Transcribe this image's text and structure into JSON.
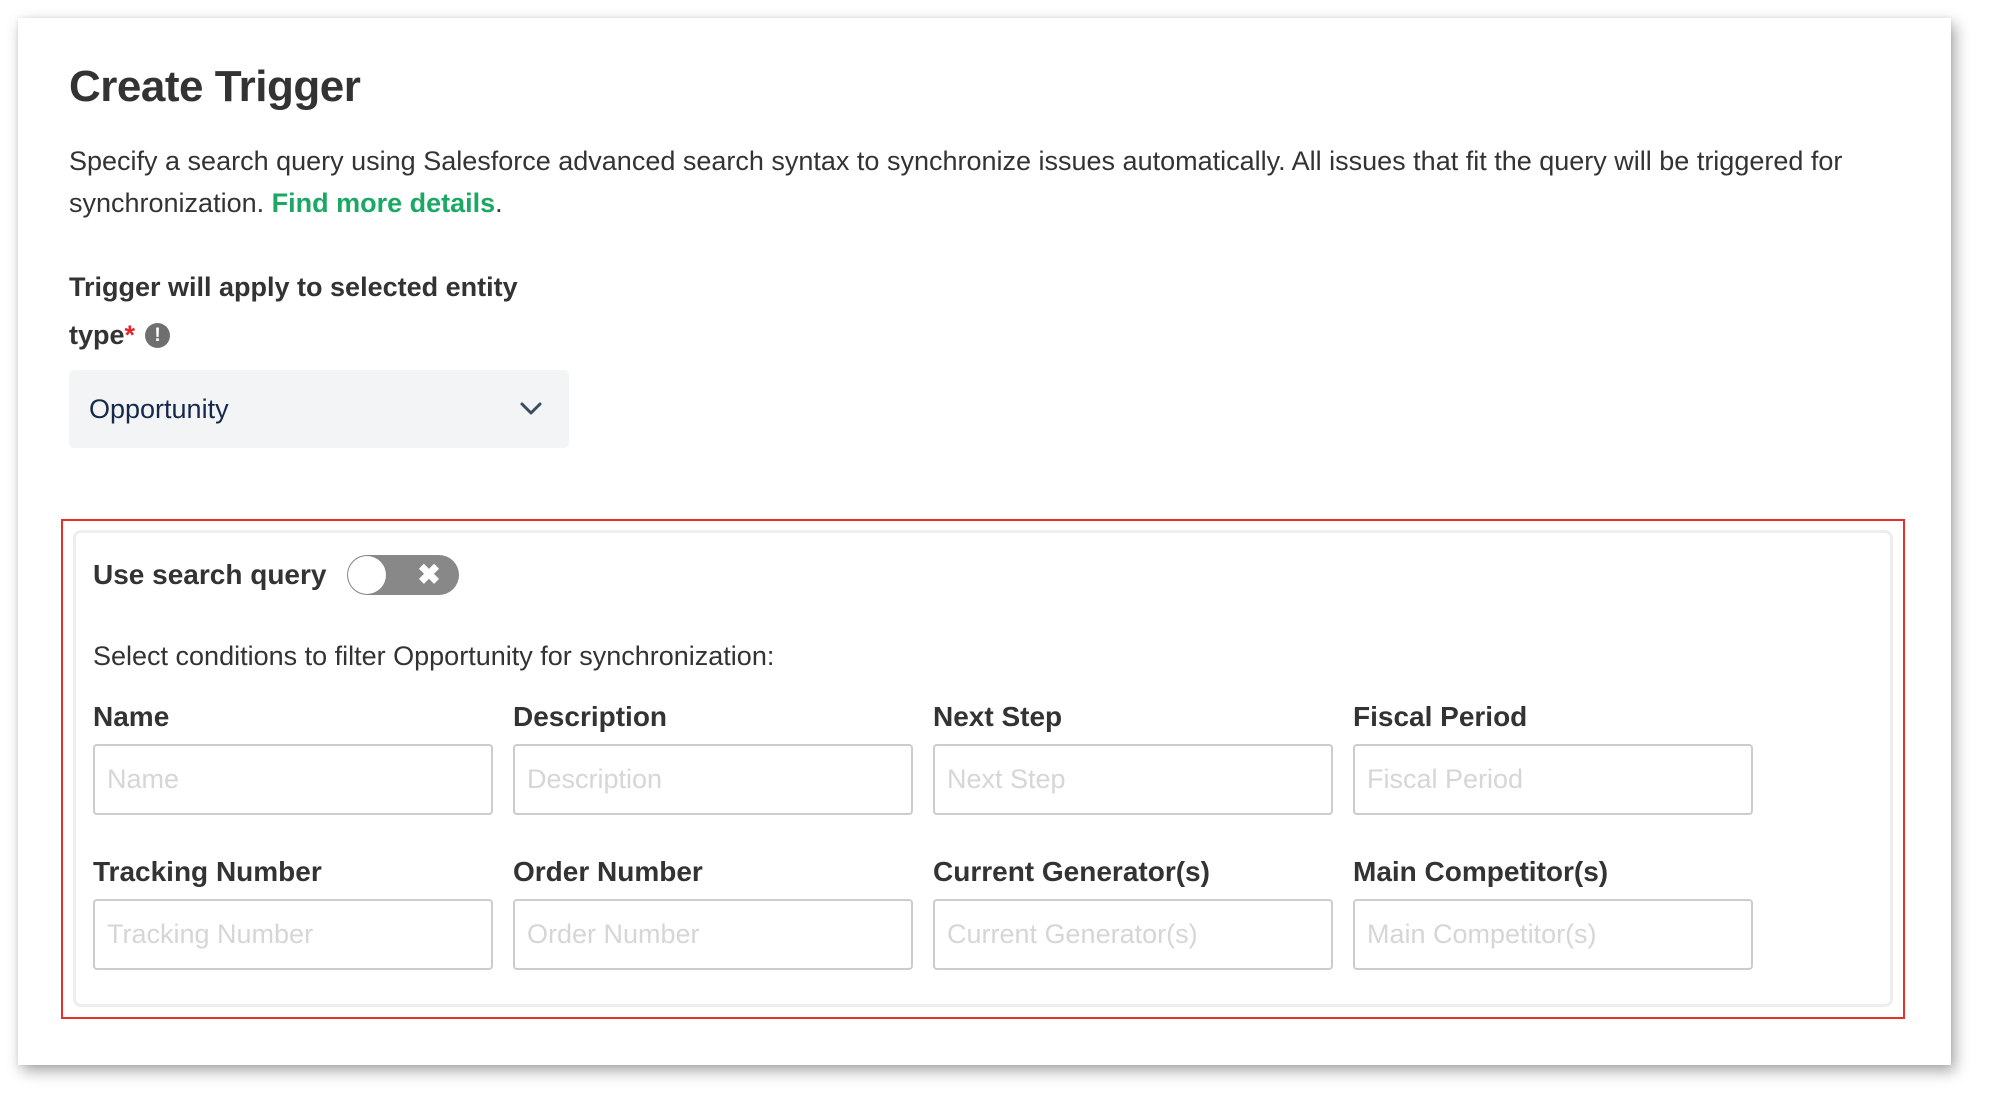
{
  "header": {
    "title": "Create Trigger",
    "description": "Specify a search query using Salesforce advanced search syntax to synchronize issues automatically. All issues that fit the query will be triggered for synchronization. ",
    "link_label": "Find more details",
    "link_suffix": "."
  },
  "entity": {
    "label": "Trigger will apply to selected entity type",
    "required_mark": "*",
    "info_icon": "!",
    "selected": "Opportunity"
  },
  "search_query": {
    "label": "Use search query",
    "toggle_state": "off",
    "toggle_icon": "✖"
  },
  "conditions": {
    "intro": "Select conditions to filter Opportunity for synchronization:",
    "fields": [
      {
        "label": "Name",
        "placeholder": "Name",
        "value": ""
      },
      {
        "label": "Description",
        "placeholder": "Description",
        "value": ""
      },
      {
        "label": "Next Step",
        "placeholder": "Next Step",
        "value": ""
      },
      {
        "label": "Fiscal Period",
        "placeholder": "Fiscal Period",
        "value": ""
      },
      {
        "label": "Tracking Number",
        "placeholder": "Tracking Number",
        "value": ""
      },
      {
        "label": "Order Number",
        "placeholder": "Order Number",
        "value": ""
      },
      {
        "label": "Current Generator(s)",
        "placeholder": "Current Generator(s)",
        "value": ""
      },
      {
        "label": "Main Competitor(s)",
        "placeholder": "Main Competitor(s)",
        "value": ""
      }
    ]
  },
  "colors": {
    "link": "#1aa864",
    "required": "#e5262a",
    "highlight_border": "#e8302b",
    "toggle_off": "#888888"
  }
}
